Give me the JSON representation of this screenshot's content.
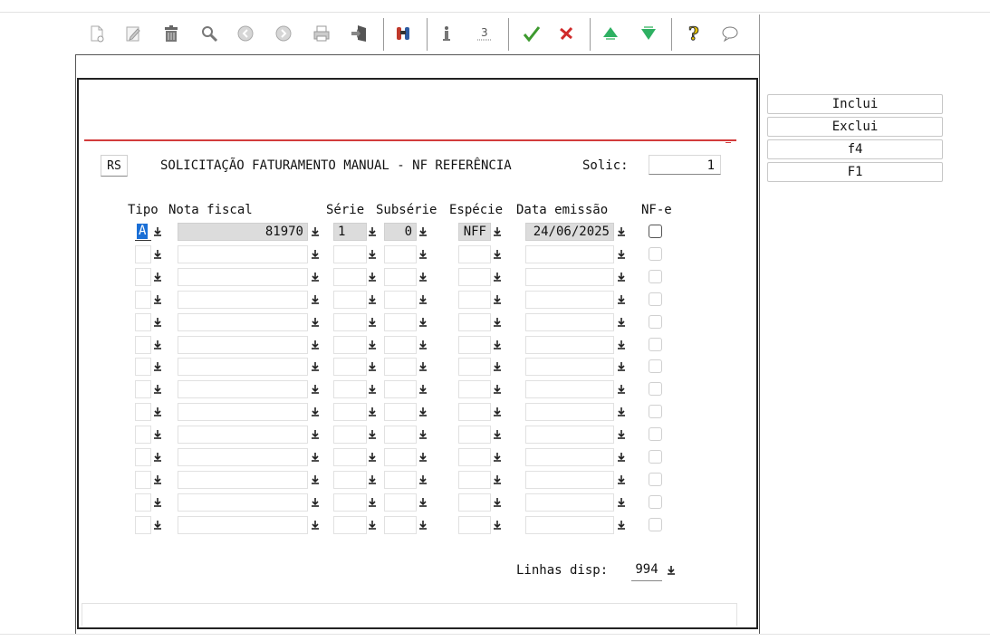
{
  "toolbar": {
    "icons": [
      "new-document-icon",
      "edit-icon",
      "trash-icon",
      "search-icon",
      "previous-icon",
      "next-icon",
      "print-icon",
      "exit-door-icon",
      "binoculars-icon",
      "info-icon",
      "counter-icon",
      "confirm-check-icon",
      "cancel-x-icon",
      "move-up-icon",
      "move-down-icon",
      "help-question-icon",
      "comment-bubble-icon"
    ]
  },
  "header": {
    "rs_label": "RS",
    "title": "SOLICITAÇÃO FATURAMENTO MANUAL - NF REFERÊNCIA",
    "solic_label": "Solic:",
    "solic_value": "1"
  },
  "table": {
    "headers": {
      "tipo": "Tipo",
      "nota_fiscal": "Nota fiscal",
      "serie": "Série",
      "subserie": "Subsérie",
      "especie": "Espécie",
      "data_emissao": "Data emissão",
      "nfe": "NF-e"
    },
    "rows": [
      {
        "tipo": "A",
        "nota_fiscal": "81970",
        "serie": "1",
        "subserie": "0",
        "especie": "NFF",
        "data_emissao": "24/06/2025",
        "nfe": false
      },
      {
        "tipo": "",
        "nota_fiscal": "",
        "serie": "",
        "subserie": "",
        "especie": "",
        "data_emissao": "",
        "nfe": false
      },
      {
        "tipo": "",
        "nota_fiscal": "",
        "serie": "",
        "subserie": "",
        "especie": "",
        "data_emissao": "",
        "nfe": false
      },
      {
        "tipo": "",
        "nota_fiscal": "",
        "serie": "",
        "subserie": "",
        "especie": "",
        "data_emissao": "",
        "nfe": false
      },
      {
        "tipo": "",
        "nota_fiscal": "",
        "serie": "",
        "subserie": "",
        "especie": "",
        "data_emissao": "",
        "nfe": false
      },
      {
        "tipo": "",
        "nota_fiscal": "",
        "serie": "",
        "subserie": "",
        "especie": "",
        "data_emissao": "",
        "nfe": false
      },
      {
        "tipo": "",
        "nota_fiscal": "",
        "serie": "",
        "subserie": "",
        "especie": "",
        "data_emissao": "",
        "nfe": false
      },
      {
        "tipo": "",
        "nota_fiscal": "",
        "serie": "",
        "subserie": "",
        "especie": "",
        "data_emissao": "",
        "nfe": false
      },
      {
        "tipo": "",
        "nota_fiscal": "",
        "serie": "",
        "subserie": "",
        "especie": "",
        "data_emissao": "",
        "nfe": false
      },
      {
        "tipo": "",
        "nota_fiscal": "",
        "serie": "",
        "subserie": "",
        "especie": "",
        "data_emissao": "",
        "nfe": false
      },
      {
        "tipo": "",
        "nota_fiscal": "",
        "serie": "",
        "subserie": "",
        "especie": "",
        "data_emissao": "",
        "nfe": false
      },
      {
        "tipo": "",
        "nota_fiscal": "",
        "serie": "",
        "subserie": "",
        "especie": "",
        "data_emissao": "",
        "nfe": false
      },
      {
        "tipo": "",
        "nota_fiscal": "",
        "serie": "",
        "subserie": "",
        "especie": "",
        "data_emissao": "",
        "nfe": false
      },
      {
        "tipo": "",
        "nota_fiscal": "",
        "serie": "",
        "subserie": "",
        "especie": "",
        "data_emissao": "",
        "nfe": false
      }
    ]
  },
  "footer": {
    "linhas_label": "Linhas disp:",
    "linhas_value": "994"
  },
  "side_buttons": {
    "inclui": "Inclui",
    "exclui": "Exclui",
    "f4": "f4",
    "F1": "F1"
  },
  "colors": {
    "accent_red": "#d23b3b",
    "selection_blue": "#1a6fd6"
  }
}
